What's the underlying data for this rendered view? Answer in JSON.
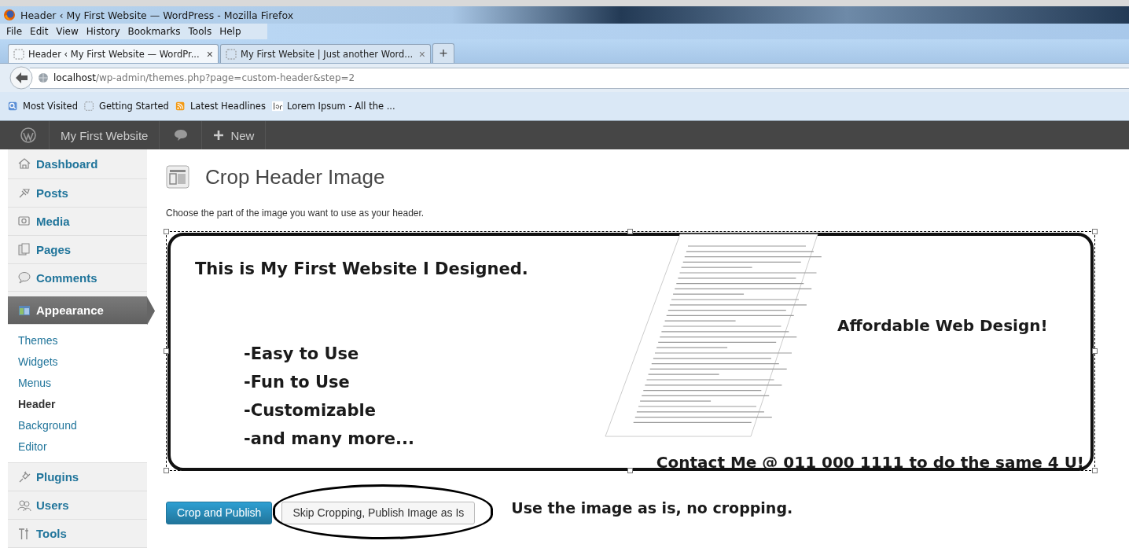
{
  "window": {
    "title": "Header ‹ My First Website — WordPress - Mozilla Firefox"
  },
  "menu_bar": [
    "File",
    "Edit",
    "View",
    "History",
    "Bookmarks",
    "Tools",
    "Help"
  ],
  "tabs": [
    {
      "label": "Header ‹ My First Website — WordPr...",
      "close": "×",
      "selected": true
    },
    {
      "label": "My First Website | Just another Word...",
      "close": "×",
      "selected": false
    }
  ],
  "new_tab": "+",
  "address_bar": {
    "host": "localhost",
    "path": "/wp-admin/themes.php?page=custom-header&step=2"
  },
  "bookmarks": [
    {
      "label": "Most Visited",
      "kind": "search"
    },
    {
      "label": "Getting Started",
      "kind": "page"
    },
    {
      "label": "Latest Headlines",
      "kind": "feed"
    },
    {
      "label": "Lorem Ipsum - All the ...",
      "kind": "lorem"
    }
  ],
  "admin_bar": {
    "site": "My First Website",
    "new": "New"
  },
  "sidebar": {
    "items": [
      {
        "label": "Dashboard",
        "selected": false
      },
      {
        "label": "Posts",
        "selected": false
      },
      {
        "label": "Media",
        "selected": false
      },
      {
        "label": "Pages",
        "selected": false
      },
      {
        "label": "Comments",
        "selected": false
      },
      {
        "label": "Appearance",
        "selected": true,
        "children": [
          {
            "label": "Themes",
            "selected": false
          },
          {
            "label": "Widgets",
            "selected": false
          },
          {
            "label": "Menus",
            "selected": false
          },
          {
            "label": "Header",
            "selected": true
          },
          {
            "label": "Background",
            "selected": false
          },
          {
            "label": "Editor",
            "selected": false
          }
        ]
      },
      {
        "label": "Plugins",
        "selected": false
      },
      {
        "label": "Users",
        "selected": false
      },
      {
        "label": "Tools",
        "selected": false
      }
    ]
  },
  "page": {
    "title": "Crop Header Image",
    "description": "Choose the part of the image you want to use as your header.",
    "header_image": {
      "headline": "This is My First Website I Designed.",
      "features": [
        "-Easy to Use",
        "-Fun to Use",
        "-Customizable",
        "-and many more..."
      ],
      "tagline": "Affordable Web Design!",
      "contact": "Contact Me @ 011 000 1111 to do the same 4 U!"
    },
    "buttons": [
      {
        "label": "Crop and Publish",
        "kind": "primary"
      },
      {
        "label": "Skip Cropping, Publish Image as Is",
        "kind": "secondary"
      }
    ]
  },
  "annotation": {
    "text": "Use the image as is, no cropping."
  }
}
